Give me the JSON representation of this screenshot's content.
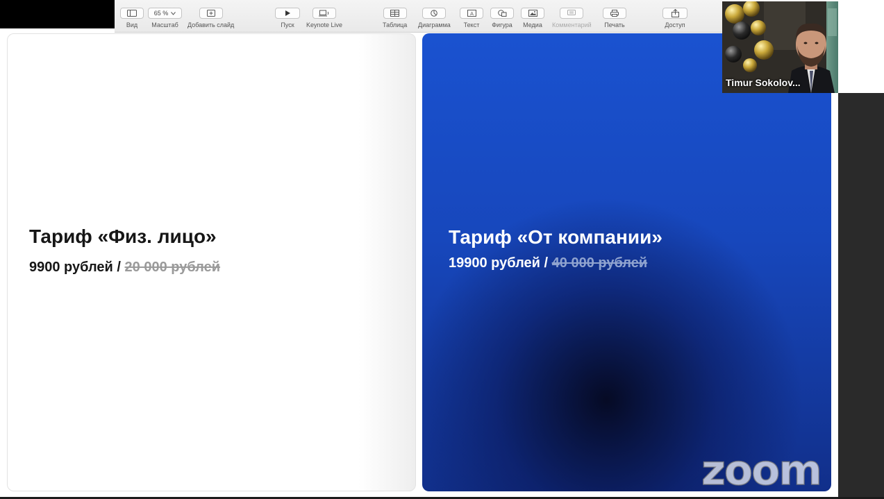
{
  "toolbar": {
    "items": [
      {
        "label": "Вид",
        "icon": "sidebar-view-icon"
      },
      {
        "label": "Масштаб",
        "value": "65 %",
        "icon": "chevron-down-icon"
      },
      {
        "label": "Добавить слайд",
        "icon": "add-slide-icon"
      },
      {
        "label": "Пуск",
        "icon": "play-icon"
      },
      {
        "label": "Keynote Live",
        "icon": "keynote-live-icon"
      },
      {
        "label": "Таблица",
        "icon": "table-icon"
      },
      {
        "label": "Диаграмма",
        "icon": "chart-icon"
      },
      {
        "label": "Текст",
        "icon": "text-box-icon"
      },
      {
        "label": "Фигура",
        "icon": "shape-icon"
      },
      {
        "label": "Медиа",
        "icon": "media-icon"
      },
      {
        "label": "Комментарий",
        "icon": "comment-icon",
        "disabled": true
      },
      {
        "label": "Печать",
        "icon": "print-icon"
      },
      {
        "label": "Доступ",
        "icon": "share-icon"
      }
    ]
  },
  "slide": {
    "left": {
      "title": "Тариф «Физ. лицо»",
      "price": "9900 рублей /",
      "old_price": "20 000 рублей"
    },
    "right": {
      "title": "Тариф «От компании»",
      "price": "19900 рублей /",
      "old_price": "40 000 рублей"
    }
  },
  "participant": {
    "name": "Timur Sokolov..."
  },
  "watermark": "zoom",
  "colors": {
    "accent_blue": "#1a52d0",
    "dark_text": "#161616",
    "strike_grey": "#9a9a9a"
  }
}
